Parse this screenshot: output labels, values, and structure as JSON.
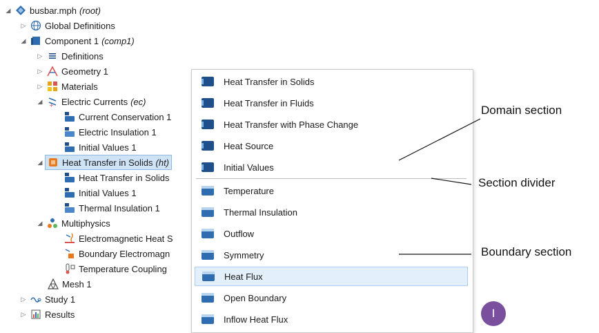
{
  "tree": {
    "root": {
      "label": "busbar.mph",
      "tag": "(root)"
    },
    "global_definitions": {
      "label": "Global Definitions"
    },
    "component": {
      "label": "Component 1",
      "tag": "(comp1)"
    },
    "definitions": {
      "label": "Definitions"
    },
    "geometry": {
      "label": "Geometry 1"
    },
    "materials": {
      "label": "Materials"
    },
    "electric_currents": {
      "label": "Electric Currents",
      "tag": "(ec)"
    },
    "ec_children": [
      "Current Conservation 1",
      "Electric Insulation 1",
      "Initial Values 1"
    ],
    "heat_transfer": {
      "label": "Heat Transfer in Solids",
      "tag": "(ht)"
    },
    "ht_children": [
      "Heat Transfer in Solids",
      "Initial Values 1",
      "Thermal Insulation 1"
    ],
    "multiphysics": {
      "label": "Multiphysics"
    },
    "mp_children": [
      "Electromagnetic Heat S",
      "Boundary Electromagn",
      "Temperature Coupling"
    ],
    "mesh": {
      "label": "Mesh 1"
    },
    "study": {
      "label": "Study 1"
    },
    "results": {
      "label": "Results"
    }
  },
  "menu": {
    "domain_items": [
      "Heat Transfer in Solids",
      "Heat Transfer in Fluids",
      "Heat Transfer with Phase Change",
      "Heat Source",
      "Initial Values"
    ],
    "boundary_items": [
      "Temperature",
      "Thermal Insulation",
      "Outflow",
      "Symmetry",
      "Heat Flux",
      "Open Boundary",
      "Inflow Heat Flux"
    ],
    "hovered_item": "Heat Flux"
  },
  "callouts": {
    "domain": "Domain section",
    "divider": "Section divider",
    "boundary": "Boundary section"
  },
  "badge": {
    "text": "I"
  },
  "colors": {
    "selection": "#cfe3f7",
    "menu_hover": "#e3f0fb",
    "domain_icon": "#1f4f8a",
    "boundary_icon": "#2f6db0",
    "badge": "#7a4f9e"
  }
}
